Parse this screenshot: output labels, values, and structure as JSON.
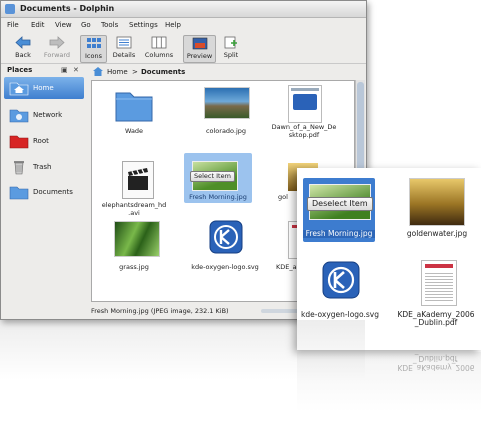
{
  "window": {
    "title": "Documents - Dolphin"
  },
  "menu": {
    "items": [
      "File",
      "Edit",
      "View",
      "Go",
      "Tools",
      "Settings",
      "Help"
    ]
  },
  "toolbar": {
    "back": "Back",
    "forward": "Forward",
    "icons": "Icons",
    "details": "Details",
    "columns": "Columns",
    "preview": "Preview",
    "split": "Split"
  },
  "sidebar": {
    "title": "Places",
    "controls": [
      "▣",
      "✕"
    ],
    "items": [
      {
        "label": "Home",
        "selected": true
      },
      {
        "label": "Network"
      },
      {
        "label": "Root"
      },
      {
        "label": "Trash"
      },
      {
        "label": "Documents"
      }
    ]
  },
  "breadcrumb": {
    "home": "Home",
    "separator": ">",
    "current": "Documents"
  },
  "files": [
    {
      "name": "Wade",
      "type": "folder"
    },
    {
      "name": "colorado.jpg",
      "type": "image"
    },
    {
      "name": "Dawn_of_a_New_Desktop.pdf",
      "lines": [
        "Dawn_of_a_New_De",
        "sktop.pdf"
      ],
      "type": "pdf"
    },
    {
      "name": "elephantsdream_hd.avi",
      "lines": [
        "elephantsdream_hd",
        ".avi"
      ],
      "type": "video"
    },
    {
      "name": "Fresh Morning.jpg",
      "type": "image",
      "selected": true
    },
    {
      "name": "gol",
      "type": "image"
    },
    {
      "name": "grass.jpg",
      "type": "image"
    },
    {
      "name": "kde-oxygen-logo.svg",
      "type": "svg"
    },
    {
      "name": "KDE_a",
      "type": "pdf"
    }
  ],
  "select_badge": "Select Item",
  "status": {
    "text": "Fresh Morning.jpg (JPEG image, 232.1 KiB)"
  },
  "zoom": {
    "deselect_badge": "Deselect Item",
    "files": [
      {
        "name": "Fresh Morning.jpg",
        "selected": true
      },
      {
        "name": "goldenwater.jpg"
      },
      {
        "name": "kde-oxygen-logo.svg"
      },
      {
        "name": "KDE_aKademy_2006_Dublin.pdf",
        "lines": [
          "KDE_aKademy_2006",
          "_Dublin.pdf"
        ]
      }
    ]
  },
  "reflection": {
    "lines": [
      "KDE_aKademy_2006",
      "_Dublin.pdf"
    ]
  },
  "colors": {
    "selection": "#3d7ccf",
    "folder": "#5b9be0",
    "kde_blue": "#2a62b8"
  }
}
